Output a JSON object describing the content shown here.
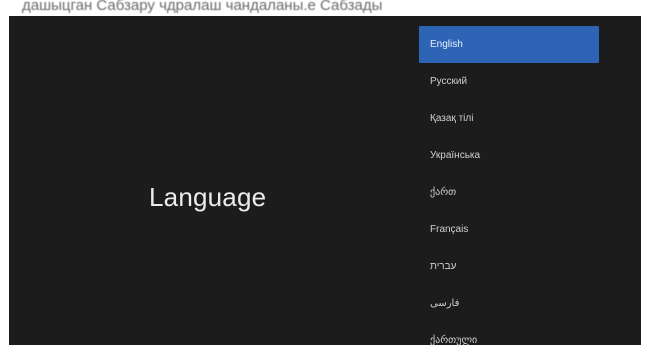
{
  "caption": "дашыцган Сабзару чдралаш чандаланы.е Сабзады",
  "screen": {
    "title": "Language",
    "selected_index": 0,
    "accent_color": "#2d64b5",
    "background_color": "#1c1c1d",
    "languages": [
      {
        "label": "English"
      },
      {
        "label": "Русский"
      },
      {
        "label": "Қазақ тілі"
      },
      {
        "label": "Українська"
      },
      {
        "label": "ქართ"
      },
      {
        "label": "Français"
      },
      {
        "label": "עברית"
      },
      {
        "label": "فارسی"
      },
      {
        "label": "ქართული"
      }
    ]
  }
}
